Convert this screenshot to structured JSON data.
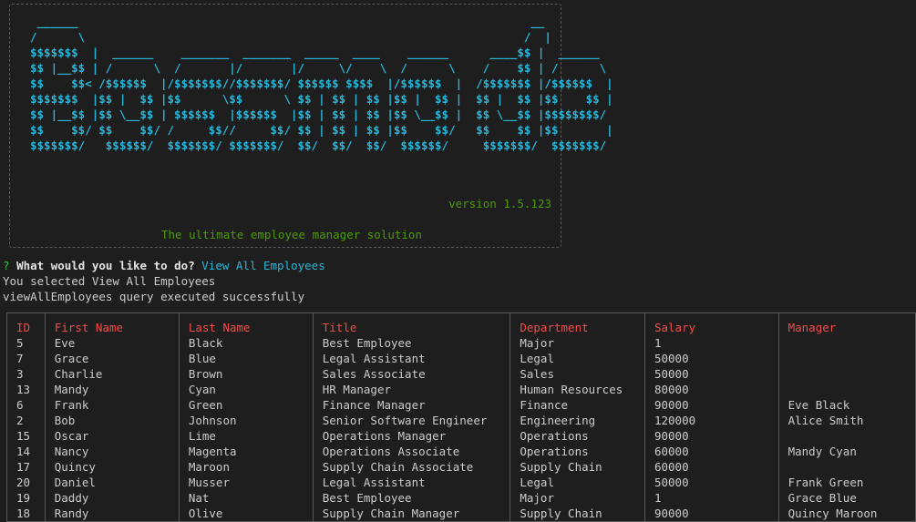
{
  "banner": {
    "ascii_lines": [
      " ______                                                                  __",
      "/      \\                                                                /  |",
      "$$$$$$$  |  ______    _______  _______  _____  ____    ______      ____$$ |  ______",
      "$$ |__$$ | /      \\  /       |/       |/     \\/    \\  /      \\    /    $$ | /      \\",
      "$$    $$< /$$$$$$  |/$$$$$$$//$$$$$$$/ $$$$$$ $$$$  |/$$$$$$  |  /$$$$$$$ |/$$$$$$  |",
      "$$$$$$$  |$$ |  $$ |$$      \\$$      \\ $$ | $$ | $$ |$$ |  $$ |  $$ |  $$ |$$    $$ |",
      "$$ |__$$ |$$ \\__$$ | $$$$$$  |$$$$$$  |$$ | $$ | $$ |$$ \\__$$ |  $$ \\__$$ |$$$$$$$$/",
      "$$    $$/ $$    $$/ /     $$//     $$/ $$ | $$ | $$ |$$    $$/   $$    $$ |$$       |",
      "$$$$$$$/   $$$$$$/  $$$$$$$/ $$$$$$$/  $$/  $$/  $$/  $$$$$$/     $$$$$$$/  $$$$$$$/"
    ],
    "version": "version 1.5.123",
    "tagline": "The ultimate employee manager solution"
  },
  "prompt": {
    "marker": "?",
    "question": "What would you like to do?",
    "answer": "View All Employees"
  },
  "output": {
    "line1": "You selected View All Employees",
    "line2": "viewAllEmployees query executed successfully"
  },
  "table": {
    "headers": [
      "ID",
      "First Name",
      "Last Name",
      "Title",
      "Department",
      "Salary",
      "Manager"
    ],
    "rows": [
      [
        "5",
        "Eve",
        "Black",
        "Best Employee",
        "Major",
        "1",
        ""
      ],
      [
        "7",
        "Grace",
        "Blue",
        "Legal Assistant",
        "Legal",
        "50000",
        ""
      ],
      [
        "3",
        "Charlie",
        "Brown",
        "Sales Associate",
        "Sales",
        "50000",
        ""
      ],
      [
        "13",
        "Mandy",
        "Cyan",
        "HR Manager",
        "Human Resources",
        "80000",
        ""
      ],
      [
        "6",
        "Frank",
        "Green",
        "Finance Manager",
        "Finance",
        "90000",
        "Eve Black"
      ],
      [
        "2",
        "Bob",
        "Johnson",
        "Senior Software Engineer",
        "Engineering",
        "120000",
        "Alice Smith"
      ],
      [
        "15",
        "Oscar",
        "Lime",
        "Operations Manager",
        "Operations",
        "90000",
        ""
      ],
      [
        "14",
        "Nancy",
        "Magenta",
        "Operations Associate",
        "Operations",
        "60000",
        "Mandy Cyan"
      ],
      [
        "17",
        "Quincy",
        "Maroon",
        "Supply Chain Associate",
        "Supply Chain",
        "60000",
        ""
      ],
      [
        "20",
        "Daniel",
        "Musser",
        "Legal Assistant",
        "Legal",
        "50000",
        "Frank Green"
      ],
      [
        "19",
        "Daddy",
        "Nat",
        "Best Employee",
        "Major",
        "1",
        "Grace Blue"
      ],
      [
        "18",
        "Randy",
        "Olive",
        "Supply Chain Manager",
        "Supply Chain",
        "90000",
        "Quincy Maroon"
      ]
    ]
  }
}
